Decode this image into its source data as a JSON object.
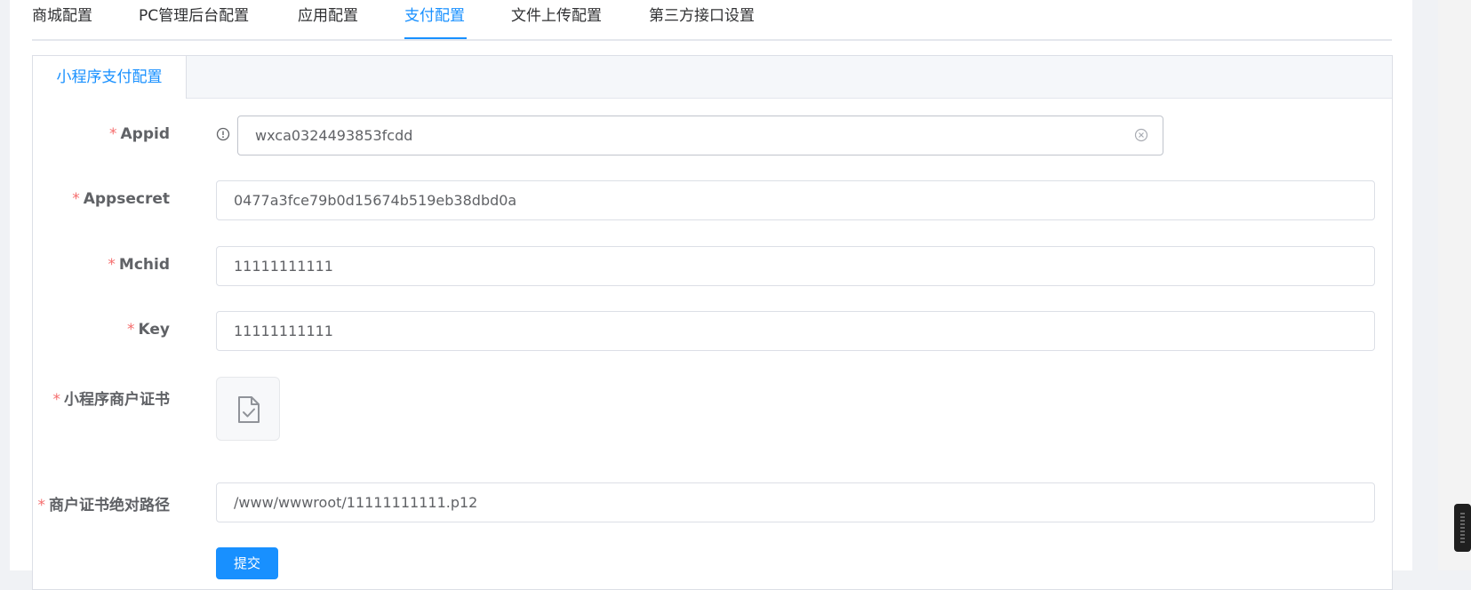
{
  "tabs": {
    "items": [
      {
        "label": "商城配置"
      },
      {
        "label": "PC管理后台配置"
      },
      {
        "label": "应用配置"
      },
      {
        "label": "支付配置"
      },
      {
        "label": "文件上传配置"
      },
      {
        "label": "第三方接口设置"
      }
    ],
    "active": "支付配置"
  },
  "card": {
    "tab_label": "小程序支付配置"
  },
  "form": {
    "required_mark": "*",
    "appid": {
      "label": "Appid",
      "value": "wxca0324493853fcdd"
    },
    "appsecret": {
      "label": "Appsecret",
      "value": "0477a3fce79b0d15674b519eb38dbd0a"
    },
    "mchid": {
      "label": "Mchid",
      "value": "11111111111"
    },
    "key": {
      "label": "Key",
      "value": "11111111111"
    },
    "cert": {
      "label": "小程序商户证书"
    },
    "cert_path": {
      "label": "商户证书绝对路径",
      "value": "/www/wwwroot/11111111111.p12"
    },
    "submit_label": "提交"
  },
  "icons": {
    "info": "info-circle-icon",
    "clear": "circle-close-icon",
    "file": "file-check-icon"
  },
  "colors": {
    "accent": "#1890ff",
    "required": "#f56c6c",
    "label": "#606266"
  }
}
